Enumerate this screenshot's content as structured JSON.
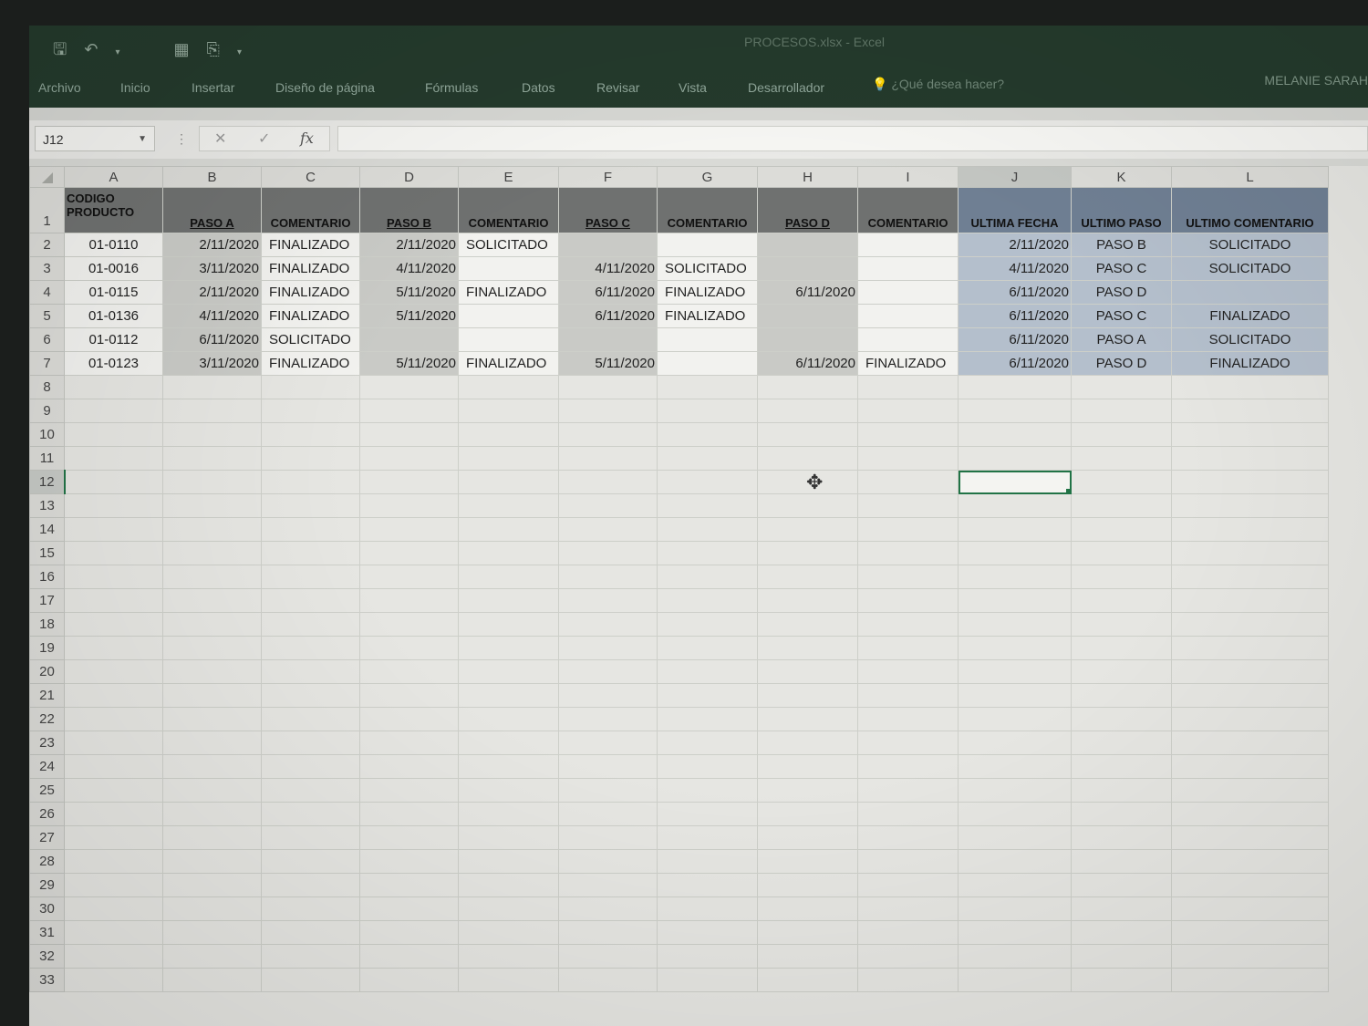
{
  "app": {
    "document_title": "PROCESOS.xlsx - Excel",
    "user_name": "MELANIE SARAH"
  },
  "ribbon": {
    "tabs": [
      "Archivo",
      "Inicio",
      "Insertar",
      "Diseño de página",
      "Fórmulas",
      "Datos",
      "Revisar",
      "Vista",
      "Desarrollador"
    ],
    "tell_me": "¿Qué desea hacer?"
  },
  "formula_bar": {
    "name_box": "J12",
    "cancel_symbol": "✕",
    "enter_symbol": "✓",
    "fx_symbol": "fx",
    "content": ""
  },
  "sheet": {
    "columns": [
      "A",
      "B",
      "C",
      "D",
      "E",
      "F",
      "G",
      "H",
      "I",
      "J",
      "K",
      "L"
    ],
    "selected_cell": "J12",
    "headers": [
      "CODIGO PRODUCTO",
      "PASO A",
      "COMENTARIO",
      "PASO B",
      "COMENTARIO",
      "PASO C",
      "COMENTARIO",
      "PASO D",
      "COMENTARIO",
      "ULTIMA FECHA",
      "ULTIMO PASO",
      "ULTIMO COMENTARIO"
    ],
    "rows": [
      [
        "01-0110",
        "2/11/2020",
        "FINALIZADO",
        "2/11/2020",
        "SOLICITADO",
        "",
        "",
        "",
        "",
        "2/11/2020",
        "PASO B",
        "SOLICITADO"
      ],
      [
        "01-0016",
        "3/11/2020",
        "FINALIZADO",
        "4/11/2020",
        "",
        "4/11/2020",
        "SOLICITADO",
        "",
        "",
        "4/11/2020",
        "PASO C",
        "SOLICITADO"
      ],
      [
        "01-0115",
        "2/11/2020",
        "FINALIZADO",
        "5/11/2020",
        "FINALIZADO",
        "6/11/2020",
        "FINALIZADO",
        "6/11/2020",
        "",
        "6/11/2020",
        "PASO D",
        ""
      ],
      [
        "01-0136",
        "4/11/2020",
        "FINALIZADO",
        "5/11/2020",
        "",
        "6/11/2020",
        "FINALIZADO",
        "",
        "",
        "6/11/2020",
        "PASO C",
        "FINALIZADO"
      ],
      [
        "01-0112",
        "6/11/2020",
        "SOLICITADO",
        "",
        "",
        "",
        "",
        "",
        "",
        "6/11/2020",
        "PASO A",
        "SOLICITADO"
      ],
      [
        "01-0123",
        "3/11/2020",
        "FINALIZADO",
        "5/11/2020",
        "FINALIZADO",
        "5/11/2020",
        "",
        "6/11/2020",
        "FINALIZADO",
        "6/11/2020",
        "PASO D",
        "FINALIZADO"
      ]
    ],
    "row_count": 33
  },
  "colors": {
    "title_bar": "#243a2c",
    "header_dark": "#6f7170",
    "header_blue": "#6f7f93",
    "data_blue": "#b4bfcc",
    "selection": "#217346"
  }
}
